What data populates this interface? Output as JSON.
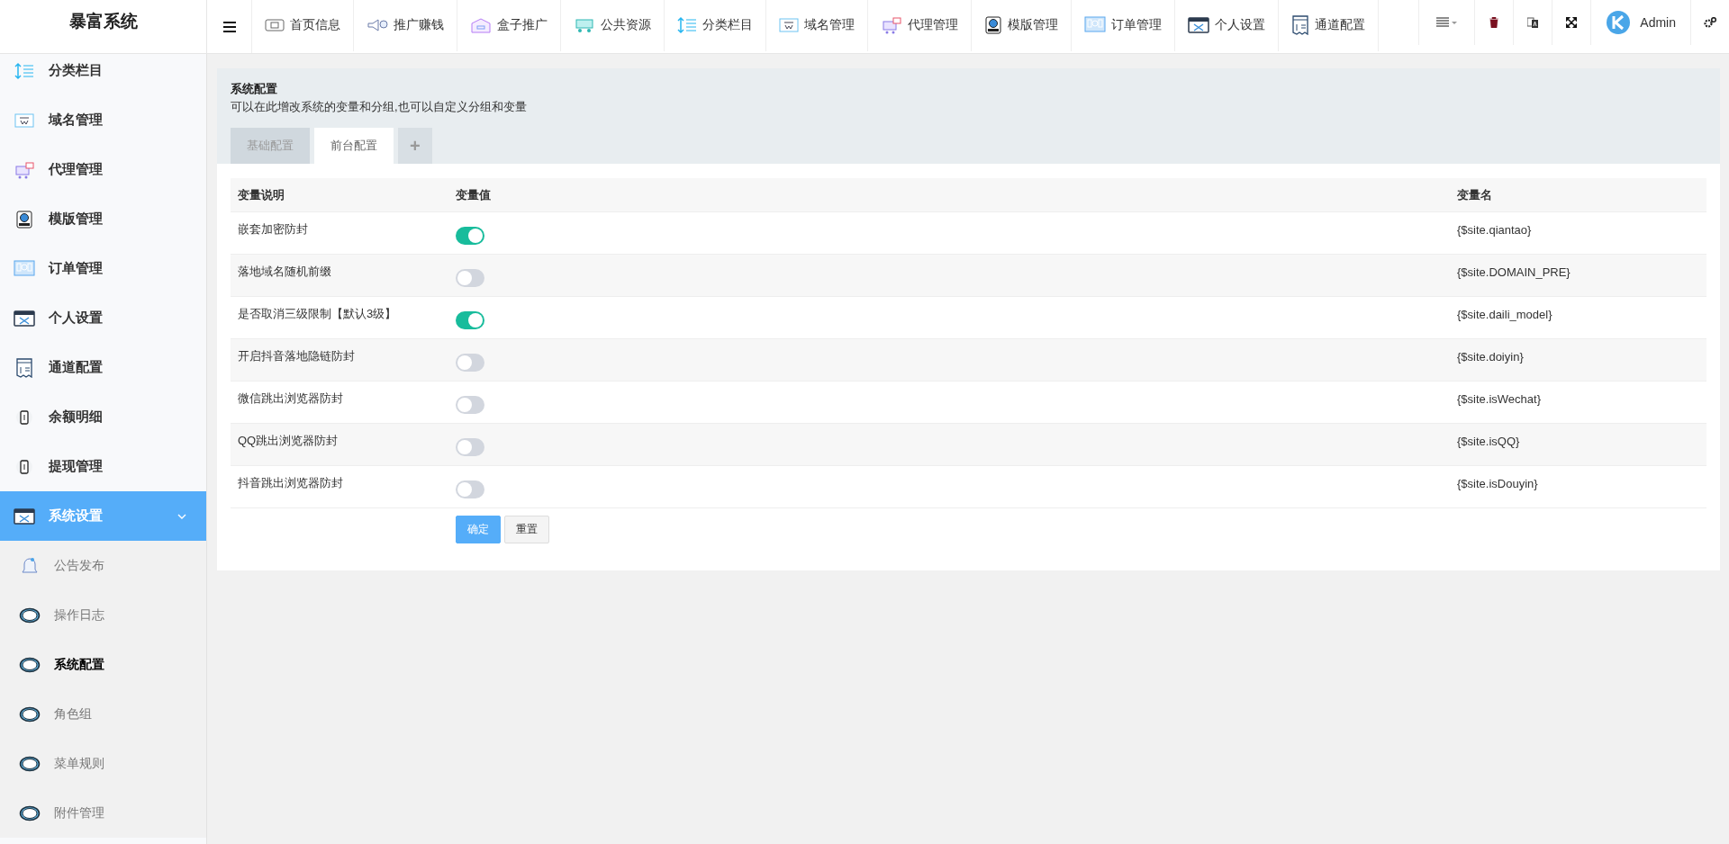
{
  "brand": "暴富系统",
  "topnav": [
    {
      "label": "首页信息"
    },
    {
      "label": "推广赚钱"
    },
    {
      "label": "盒子推广"
    },
    {
      "label": "公共资源"
    },
    {
      "label": "分类栏目"
    },
    {
      "label": "域名管理"
    },
    {
      "label": "代理管理"
    },
    {
      "label": "模版管理"
    },
    {
      "label": "订单管理"
    },
    {
      "label": "个人设置"
    },
    {
      "label": "通道配置"
    }
  ],
  "user": {
    "name": "Admin"
  },
  "sidebar": {
    "items": [
      {
        "label": "分类栏目",
        "selected": false
      },
      {
        "label": "域名管理",
        "selected": false
      },
      {
        "label": "代理管理",
        "selected": false
      },
      {
        "label": "模版管理",
        "selected": false
      },
      {
        "label": "订单管理",
        "selected": false
      },
      {
        "label": "个人设置",
        "selected": false
      },
      {
        "label": "通道配置",
        "selected": false
      },
      {
        "label": "余额明细",
        "selected": false
      },
      {
        "label": "提现管理",
        "selected": false
      },
      {
        "label": "系统设置",
        "selected": true,
        "expanded": true,
        "children": [
          {
            "label": "公告发布",
            "selected": false
          },
          {
            "label": "操作日志",
            "selected": false
          },
          {
            "label": "系统配置",
            "selected": true
          },
          {
            "label": "角色组",
            "selected": false
          },
          {
            "label": "菜单规则",
            "selected": false
          },
          {
            "label": "附件管理",
            "selected": false
          }
        ]
      }
    ]
  },
  "panel": {
    "title": "系统配置",
    "description": "可以在此增改系统的变量和分组,也可以自定义分组和变量",
    "tabs": [
      {
        "label": "基础配置",
        "selected": false
      },
      {
        "label": "前台配置",
        "selected": true
      }
    ],
    "add_tab": "+",
    "table": {
      "columns": [
        "变量说明",
        "变量值",
        "变量名"
      ],
      "rows": [
        {
          "description": "嵌套加密防封",
          "on": true,
          "variable": "{$site.qiantao}"
        },
        {
          "description": "落地域名随机前缀",
          "on": false,
          "variable": "{$site.DOMAIN_PRE}"
        },
        {
          "description": "是否取消三级限制【默认3级】",
          "on": true,
          "variable": "{$site.daili_model}"
        },
        {
          "description": "开启抖音落地隐链防封",
          "on": false,
          "variable": "{$site.doiyin}"
        },
        {
          "description": "微信跳出浏览器防封",
          "on": false,
          "variable": "{$site.isWechat}"
        },
        {
          "description": "QQ跳出浏览器防封",
          "on": false,
          "variable": "{$site.isQQ}"
        },
        {
          "description": "抖音跳出浏览器防封",
          "on": false,
          "variable": "{$site.isDouyin}"
        }
      ]
    },
    "buttons": [
      {
        "label": "确定",
        "kind": "primary"
      },
      {
        "label": "重置",
        "kind": "default"
      }
    ]
  }
}
